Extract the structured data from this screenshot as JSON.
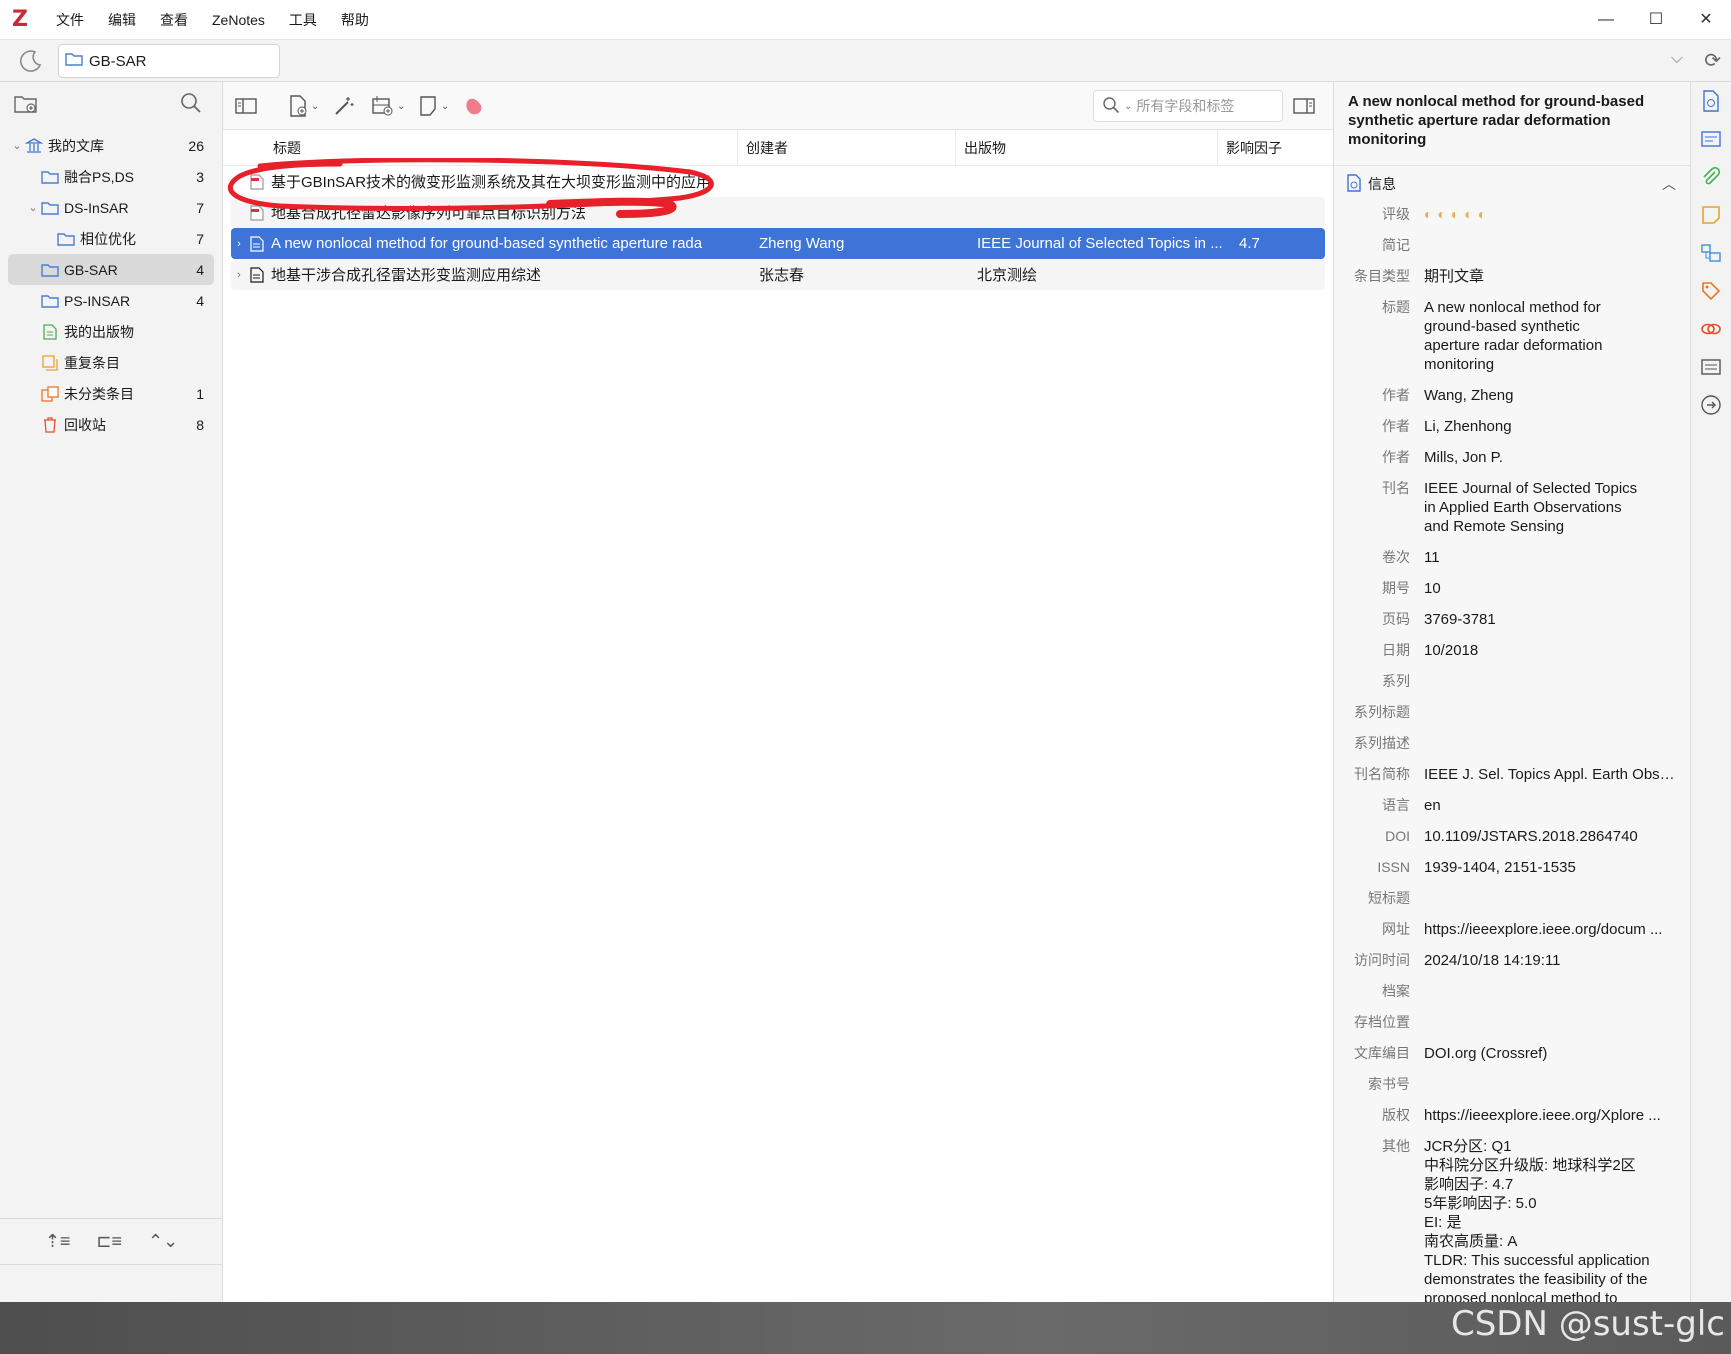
{
  "app": {
    "logo": "Z",
    "menu": [
      "文件",
      "编辑",
      "查看",
      "ZeNotes",
      "工具",
      "帮助"
    ],
    "window_controls": [
      "—",
      "☐",
      "✕"
    ]
  },
  "tab": {
    "label": "GB-SAR"
  },
  "collections": [
    {
      "label": "我的文库",
      "count": "26",
      "icon": "library-icon",
      "twisty": "⌄",
      "indent": 0
    },
    {
      "label": "融合PS,DS",
      "count": "3",
      "icon": "folder-icon",
      "twisty": "",
      "indent": 1
    },
    {
      "label": "DS-InSAR",
      "count": "7",
      "icon": "folder-icon",
      "twisty": "⌄",
      "indent": 1
    },
    {
      "label": "相位优化",
      "count": "7",
      "icon": "folder-icon",
      "twisty": "",
      "indent": 2
    },
    {
      "label": "GB-SAR",
      "count": "4",
      "icon": "folder-icon",
      "twisty": "",
      "indent": 1,
      "selected": true
    },
    {
      "label": "PS-INSAR",
      "count": "4",
      "icon": "folder-icon",
      "twisty": "",
      "indent": 1
    },
    {
      "label": "我的出版物",
      "count": "",
      "icon": "publications-icon",
      "twisty": "",
      "indent": 1
    },
    {
      "label": "重复条目",
      "count": "",
      "icon": "duplicates-icon",
      "twisty": "",
      "indent": 1
    },
    {
      "label": "未分类条目",
      "count": "1",
      "icon": "unfiled-icon",
      "twisty": "",
      "indent": 1
    },
    {
      "label": "回收站",
      "count": "8",
      "icon": "trash-icon",
      "twisty": "",
      "indent": 1
    }
  ],
  "search": {
    "placeholder": "所有字段和标签"
  },
  "columns": {
    "title": "标题",
    "creator": "创建者",
    "publication": "出版物",
    "impact": "影响因子"
  },
  "items": [
    {
      "title": "基于GBInSAR技术的微变形监测系统及其在大坝变形监测中的应用",
      "creator": "",
      "publication": "",
      "impact": "",
      "icon": "pdf-icon",
      "twisty": ""
    },
    {
      "title": "地基合成孔径雷达影像序列可靠点目标识别方法",
      "creator": "",
      "publication": "",
      "impact": "",
      "icon": "pdf-icon",
      "twisty": ""
    },
    {
      "title": "A new nonlocal method for ground-based synthetic aperture rada",
      "creator": "Zheng Wang",
      "publication": "IEEE Journal of Selected Topics in ...",
      "impact": "4.7",
      "icon": "document-icon",
      "twisty": "›",
      "selected": true
    },
    {
      "title": "地基干涉合成孔径雷达形变监测应用综述",
      "creator": "张志春",
      "publication": "北京测绘",
      "impact": "",
      "icon": "document-icon",
      "twisty": "›"
    }
  ],
  "detail": {
    "header": "A new nonlocal method for ground-based synthetic aperture radar deformation monitoring",
    "section": "信息",
    "fields": [
      {
        "label": "评级",
        "value": "",
        "stars": "◐◐◐◐◐"
      },
      {
        "label": "简记",
        "value": ""
      },
      {
        "label": "条目类型",
        "value": "期刊文章"
      },
      {
        "label": "标题",
        "value": "A new nonlocal method for\nground-based synthetic\naperture radar deformation\nmonitoring"
      },
      {
        "label": "作者",
        "value": "Wang, Zheng"
      },
      {
        "label": "作者",
        "value": "Li, Zhenhong"
      },
      {
        "label": "作者",
        "value": "Mills, Jon P."
      },
      {
        "label": "刊名",
        "value": "IEEE Journal of Selected Topics\nin Applied Earth Observations\nand Remote Sensing"
      },
      {
        "label": "卷次",
        "value": "11"
      },
      {
        "label": "期号",
        "value": "10"
      },
      {
        "label": "页码",
        "value": "3769-3781"
      },
      {
        "label": "日期",
        "value": "10/2018"
      },
      {
        "label": "系列",
        "value": ""
      },
      {
        "label": "系列标题",
        "value": ""
      },
      {
        "label": "系列描述",
        "value": ""
      },
      {
        "label": "刊名简称",
        "value": "IEEE J. Sel. Topics Appl. Earth Obse ...",
        "trunc": true
      },
      {
        "label": "语言",
        "value": "en"
      },
      {
        "label": "DOI",
        "value": "10.1109/JSTARS.2018.2864740"
      },
      {
        "label": "ISSN",
        "value": "1939-1404, 2151-1535"
      },
      {
        "label": "短标题",
        "value": ""
      },
      {
        "label": "网址",
        "value": "https://ieeexplore.ieee.org/docum ...",
        "trunc": true
      },
      {
        "label": "访问时间",
        "value": "2024/10/18 14:19:11"
      },
      {
        "label": "档案",
        "value": ""
      },
      {
        "label": "存档位置",
        "value": ""
      },
      {
        "label": "文库编目",
        "value": "DOI.org (Crossref)"
      },
      {
        "label": "索书号",
        "value": ""
      },
      {
        "label": "版权",
        "value": "https://ieeexplore.ieee.org/Xplore ...",
        "trunc": true
      },
      {
        "label": "其他",
        "value": "JCR分区: Q1\n中科院分区升级版: 地球科学2区\n影响因子: 4.7\n5年影响因子: 5.0\nEI: 是\n南农高质量: A\nTLDR: This successful application\ndemonstrates the feasibility of the\nproposed nonlocal method to\nfacilitate the adoption of GBSAR for\ndeformation monitoring\napplications and demonstrates that\nthe new approach has advantages"
      }
    ]
  },
  "watermark": "CSDN @sust-glc",
  "colors": {
    "accent": "#3e73d7",
    "annotation": "#e8202a",
    "logo": "#cc2936"
  }
}
